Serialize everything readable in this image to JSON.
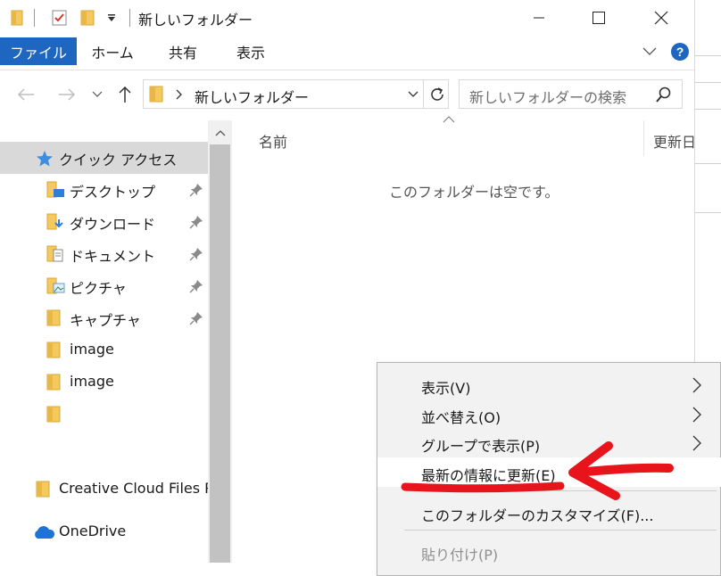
{
  "window": {
    "title": "新しいフォルダー",
    "minimize": "minimize",
    "maximize": "maximize",
    "close": "close"
  },
  "ribbon": {
    "tabs": [
      "ファイル",
      "ホーム",
      "共有",
      "表示"
    ]
  },
  "address": {
    "path": "新しいフォルダー",
    "search_placeholder": "新しいフォルダーの検索"
  },
  "navpane": {
    "items": [
      {
        "label": "クイック アクセス",
        "icon": "star-icon"
      },
      {
        "label": "デスクトップ",
        "icon": "folder-desktop-icon",
        "pinned": true
      },
      {
        "label": "ダウンロード",
        "icon": "folder-download-icon",
        "pinned": true
      },
      {
        "label": "ドキュメント",
        "icon": "folder-documents-icon",
        "pinned": true
      },
      {
        "label": "ピクチャ",
        "icon": "folder-pictures-icon",
        "pinned": true
      },
      {
        "label": "キャプチャ",
        "icon": "folder-icon",
        "pinned": true
      },
      {
        "label": "image",
        "icon": "folder-icon"
      },
      {
        "label": "image",
        "icon": "folder-icon"
      },
      {
        "label": "",
        "icon": "folder-icon"
      },
      {
        "label": "Creative Cloud Files P",
        "icon": "folder-icon"
      },
      {
        "label": "OneDrive",
        "icon": "cloud-icon"
      }
    ]
  },
  "content": {
    "column_name": "名前",
    "column_date": "更新日",
    "empty_message": "このフォルダーは空です。"
  },
  "context_menu": {
    "items": [
      {
        "label": "表示(V)",
        "submenu": true
      },
      {
        "label": "並べ替え(O)",
        "submenu": true
      },
      {
        "label": "グループで表示(P)",
        "submenu": true
      },
      {
        "label": "最新の情報に更新(E)",
        "highlighted": true
      },
      {
        "label": "このフォルダーのカスタマイズ(F)..."
      },
      {
        "label": "貼り付け(P)",
        "disabled": true
      }
    ]
  },
  "colors": {
    "file_tab": "#1f66c1",
    "selection": "#cde8ff",
    "annotation_red": "#e8141b"
  }
}
